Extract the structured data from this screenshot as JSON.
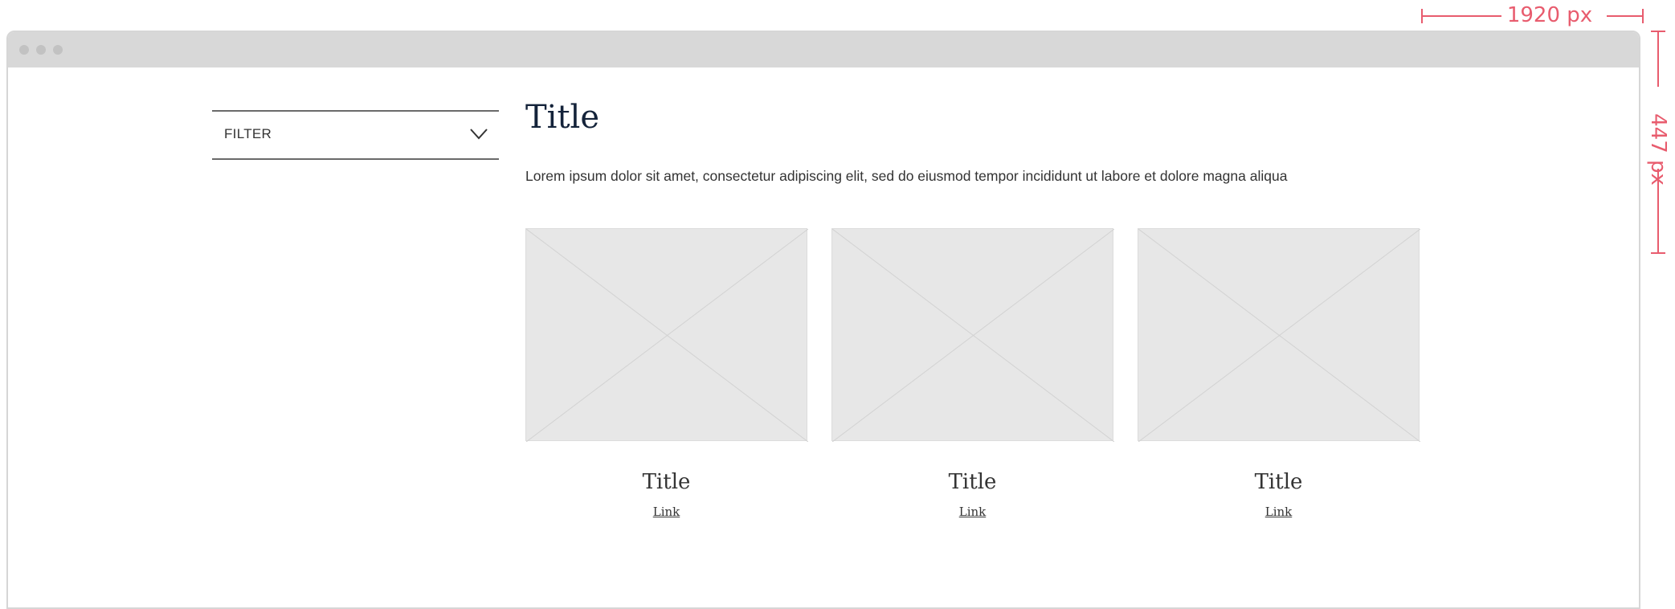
{
  "annotations": {
    "width_label": "1920 px",
    "height_label": "447 px",
    "color": "#e85c6e"
  },
  "filter": {
    "label": "FILTER",
    "icon": "chevron-down-icon"
  },
  "main": {
    "title": "Title",
    "intro": "Lorem ipsum dolor sit amet, consectetur adipiscing elit, sed do eiusmod tempor incididunt ut labore et dolore magna aliqua"
  },
  "cards": [
    {
      "title": "Title",
      "link": "Link",
      "image": "placeholder-image"
    },
    {
      "title": "Title",
      "link": "Link",
      "image": "placeholder-image"
    },
    {
      "title": "Title",
      "link": "Link",
      "image": "placeholder-image"
    }
  ]
}
